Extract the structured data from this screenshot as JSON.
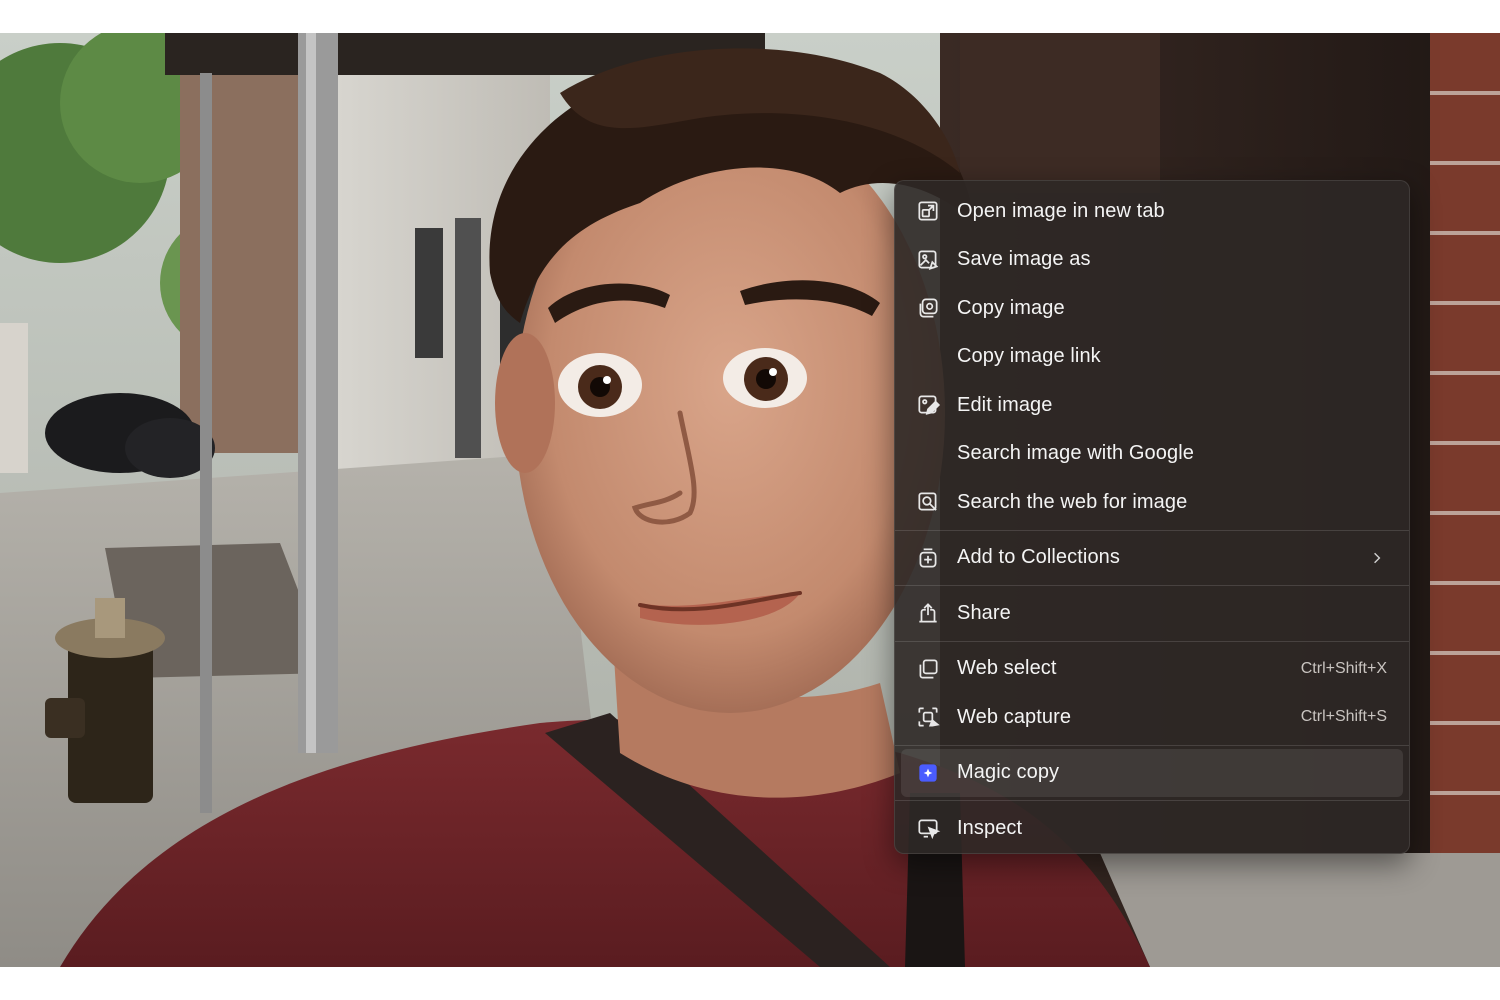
{
  "context_menu": {
    "items": [
      {
        "label": "Open image in new tab",
        "icon": "open-new-tab-icon"
      },
      {
        "label": "Save image as",
        "icon": "save-image-icon"
      },
      {
        "label": "Copy image",
        "icon": "copy-image-icon"
      },
      {
        "label": "Copy image link",
        "icon": ""
      },
      {
        "label": "Edit image",
        "icon": "edit-image-icon"
      },
      {
        "label": "Search image with Google",
        "icon": ""
      },
      {
        "label": "Search the web for image",
        "icon": "visual-search-icon"
      },
      {
        "label": "Add to Collections",
        "icon": "collections-icon",
        "submenu": true
      },
      {
        "label": "Share",
        "icon": "share-icon"
      },
      {
        "label": "Web select",
        "icon": "web-select-icon",
        "shortcut": "Ctrl+Shift+X"
      },
      {
        "label": "Web capture",
        "icon": "web-capture-icon",
        "shortcut": "Ctrl+Shift+S"
      },
      {
        "label": "Magic copy",
        "icon": "magic-copy-icon",
        "highlighted": true
      },
      {
        "label": "Inspect",
        "icon": "inspect-icon"
      }
    ]
  },
  "colors": {
    "menu_background": "#2e2826",
    "menu_text": "#f4f4f4",
    "magic_copy_accent": "#4a5cff"
  }
}
